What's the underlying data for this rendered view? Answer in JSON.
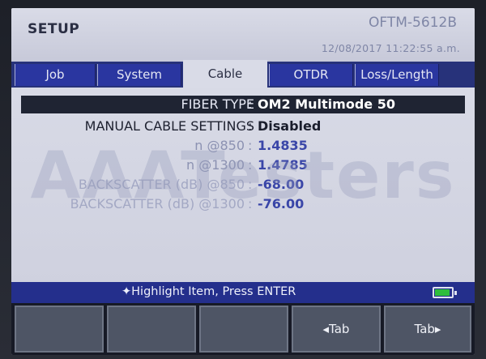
{
  "header": {
    "title": "SETUP",
    "model": "OFTM-5612B",
    "datetime": "12/08/2017   11:22:55 a.m."
  },
  "tabs": [
    {
      "label": "Job",
      "active": false
    },
    {
      "label": "System",
      "active": false
    },
    {
      "label": "Cable",
      "active": true
    },
    {
      "label": "OTDR",
      "active": false
    },
    {
      "label": "Loss/Length",
      "active": false
    }
  ],
  "settings": {
    "fiber_type": {
      "label": "FIBER TYPE",
      "value": "OM2 Multimode 50"
    },
    "manual_cable": {
      "label": "MANUAL CABLE SETTINGS",
      "value": "Disabled"
    },
    "n850": {
      "label": "n @850",
      "value": "1.4835"
    },
    "n1300": {
      "label": "n @1300",
      "value": "1.4785"
    },
    "bs850": {
      "label": "BACKSCATTER (dB) @850",
      "value": "-68.00"
    },
    "bs1300": {
      "label": "BACKSCATTER (dB) @1300",
      "value": "-76.00"
    },
    "separator": ":"
  },
  "watermark": "AAATesters",
  "status": {
    "hint": "✦Highlight Item, Press ENTER",
    "battery_level": 0.8,
    "battery_color": "#2fbe3c"
  },
  "softkeys": [
    {
      "label": ""
    },
    {
      "label": ""
    },
    {
      "label": ""
    },
    {
      "label": "◂Tab"
    },
    {
      "label": "Tab▸"
    }
  ],
  "colors": {
    "tab_bar": "#27327a",
    "status_bar": "#242f8c",
    "value_blue": "#3a46a8"
  }
}
